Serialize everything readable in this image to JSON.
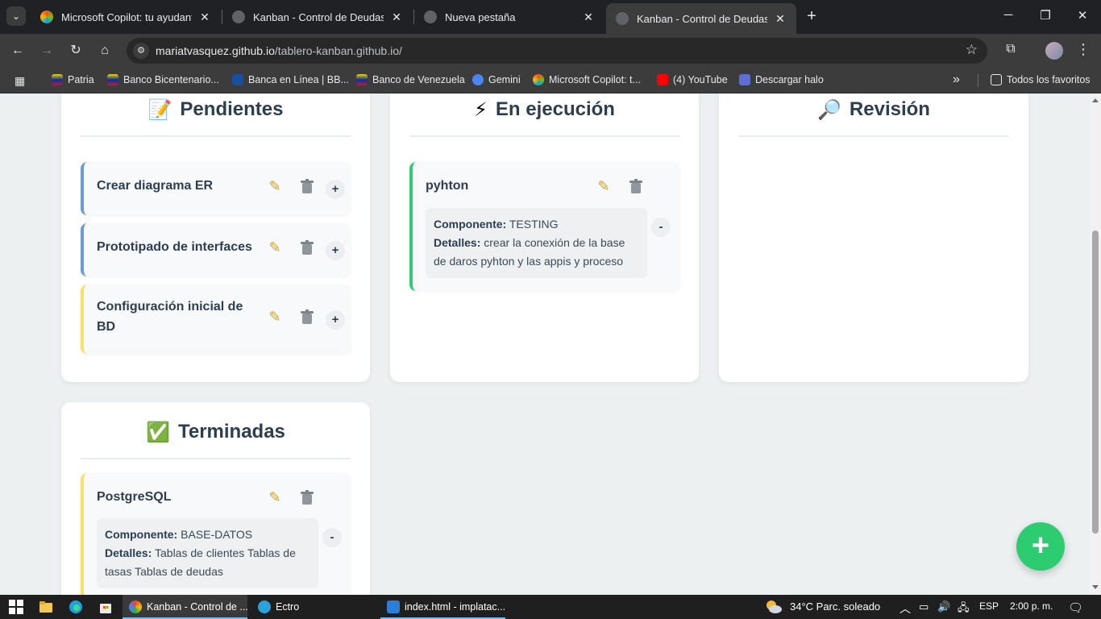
{
  "browser": {
    "tabs": [
      {
        "title": "Microsoft Copilot: tu ayudante",
        "active": false
      },
      {
        "title": "Kanban - Control de Deudas",
        "active": false
      },
      {
        "title": "Nueva pestaña",
        "active": false
      },
      {
        "title": "Kanban - Control de Deudas",
        "active": true
      }
    ],
    "url_host": "mariatvasquez.github.io",
    "url_path": "/tablero-kanban.github.io/",
    "bookmarks": [
      "Patria",
      "Banco Bicentenario...",
      "Banca en Línea | BB...",
      "Banco de Venezuela",
      "Gemini",
      "Microsoft Copilot: t...",
      "(4) YouTube",
      "Descargar halo"
    ],
    "all_bookmarks": "Todos los favoritos"
  },
  "board": {
    "columns": {
      "pending": {
        "emoji": "📝",
        "title": "Pendientes"
      },
      "progress": {
        "emoji": "⚡",
        "title": "En ejecución"
      },
      "review": {
        "emoji": "🔎",
        "title": "Revisión"
      },
      "done": {
        "emoji": "✅",
        "title": "Terminadas"
      }
    },
    "pending_cards": [
      {
        "title": "Crear diagrama ER",
        "toggle": "+",
        "color": "#6c9bd2"
      },
      {
        "title": "Prototipado de interfaces",
        "toggle": "+",
        "color": "#6c9bd2"
      },
      {
        "title": "Configuración inicial de BD",
        "toggle": "+",
        "color": "#f9e06a"
      }
    ],
    "progress_cards": [
      {
        "title": "pyhton",
        "toggle": "-",
        "color": "#2ecc71",
        "component_label": "Componente:",
        "component": "TESTING",
        "details_label": "Detalles:",
        "details": "crear la conexión de la base de daros pyhton y las appis y proceso"
      }
    ],
    "done_cards": [
      {
        "title": "PostgreSQL",
        "toggle": "-",
        "color": "#f9e06a",
        "component_label": "Componente:",
        "component": "BASE-DATOS",
        "details_label": "Detalles:",
        "details": "Tablas de clientes Tablas de tasas Tablas de deudas"
      }
    ],
    "fab_label": "+"
  },
  "taskbar": {
    "apps": [
      "Kanban - Control de ...",
      "Ectro",
      "index.html - implatac..."
    ],
    "weather": "34°C  Parc. soleado",
    "lang": "ESP",
    "time": "2:00 p. m."
  }
}
